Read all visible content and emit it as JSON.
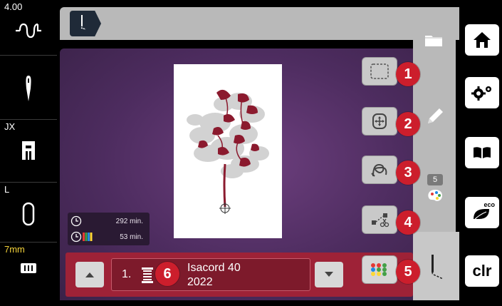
{
  "status": {
    "stitch_width": "4.00",
    "presser_foot_letter": "JX",
    "bobbin_letter": "L",
    "hoop_size": "7mm"
  },
  "embroidery": {
    "total_time": "292 min.",
    "remaining_time": "53 min."
  },
  "color_change": {
    "index": "1.",
    "thread_brand": "Isacord 40",
    "thread_number": "2022"
  },
  "color_count": "5",
  "badges": [
    "1",
    "2",
    "3",
    "4",
    "5",
    "6"
  ],
  "nav": {
    "clr_label": "clr",
    "eco_label": "eco"
  },
  "colors": {
    "accent_red": "#cc1e2c",
    "color_bar": "#9e2237",
    "workspace": "#5a3369",
    "design_red": "#8b1a2e"
  }
}
